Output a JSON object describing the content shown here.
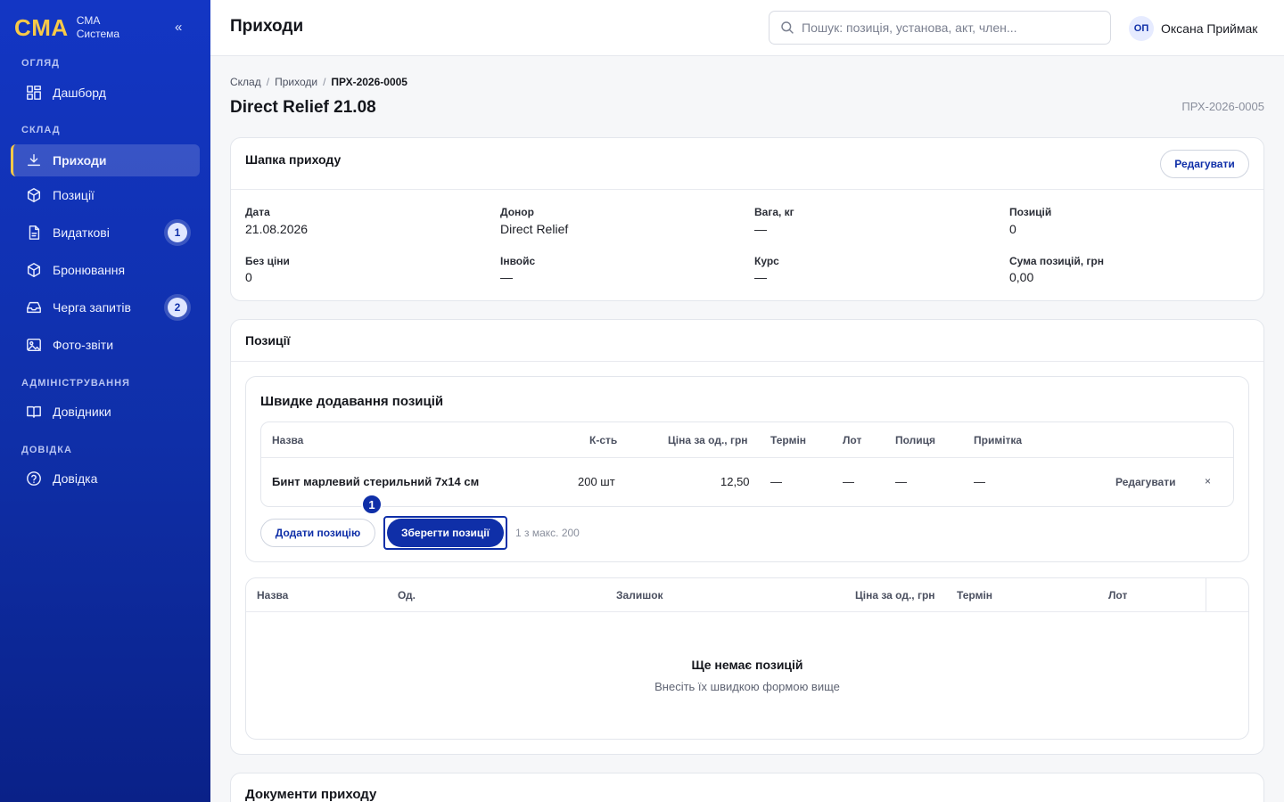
{
  "sidebar": {
    "logo": "CMA",
    "brand_line1": "CMA",
    "brand_line2": "Система",
    "collapse": "«",
    "sections": {
      "overview": "ОГЛЯД",
      "warehouse": "СКЛАД",
      "admin": "АДМІНІСТРУВАННЯ",
      "help": "ДОВІДКА"
    },
    "items": {
      "dashboard": "Дашборд",
      "receipts": "Приходи",
      "positions": "Позиції",
      "expenses": "Видаткові",
      "booking": "Бронювання",
      "queue": "Черга запитів",
      "photo": "Фото-звіти",
      "directories": "Довідники",
      "help": "Довідка"
    },
    "badges": {
      "expenses": "1",
      "queue": "2"
    }
  },
  "topbar": {
    "title": "Приходи",
    "search_placeholder": "Пошук: позиція, установа, акт, член...",
    "avatar_initials": "ОП",
    "user_name": "Оксана Приймак"
  },
  "breadcrumb": {
    "level1": "Склад",
    "sep": "/",
    "level2": "Приходи",
    "current": "ПРХ-2026-0005"
  },
  "document": {
    "title": "Direct Relief 21.08",
    "code": "ПРХ-2026-0005"
  },
  "header_card": {
    "title": "Шапка приходу",
    "edit_label": "Редагувати",
    "fields": {
      "date_label": "Дата",
      "date_value": "21.08.2026",
      "donor_label": "Донор",
      "donor_value": "Direct Relief",
      "weight_label": "Вага, кг",
      "weight_value": "—",
      "positions_label": "Позицій",
      "positions_value": "0",
      "noprice_label": "Без ціни",
      "noprice_value": "0",
      "invoice_label": "Інвойс",
      "invoice_value": "—",
      "rate_label": "Курс",
      "rate_value": "—",
      "sum_label": "Сума позицій, грн",
      "sum_value": "0,00"
    }
  },
  "positions_card": {
    "title": "Позиції",
    "quick_add": {
      "title": "Швидке додавання позицій",
      "columns": {
        "name": "Назва",
        "qty": "К-сть",
        "price": "Ціна за од., грн",
        "term": "Термін",
        "lot": "Лот",
        "shelf": "Полиця",
        "note": "Примітка"
      },
      "row": {
        "name": "Бинт марлевий стерильний 7х14 см",
        "qty": "200 шт",
        "price": "12,50",
        "term": "—",
        "lot": "—",
        "shelf": "—",
        "note": "—",
        "edit": "Редагувати",
        "remove": "×"
      },
      "add_label": "Додати позицію",
      "save_label": "Зберегти позиції",
      "step": "1",
      "limit_hint": "1 з макс. 200"
    },
    "table": {
      "columns": {
        "name": "Назва",
        "unit": "Од.",
        "balance": "Залишок",
        "price": "Ціна за од., грн",
        "term": "Термін",
        "lot": "Лот"
      },
      "empty_title": "Ще немає позицій",
      "empty_sub": "Внесіть їх швидкою формою вище"
    }
  },
  "documents_card": {
    "title": "Документи приходу"
  }
}
